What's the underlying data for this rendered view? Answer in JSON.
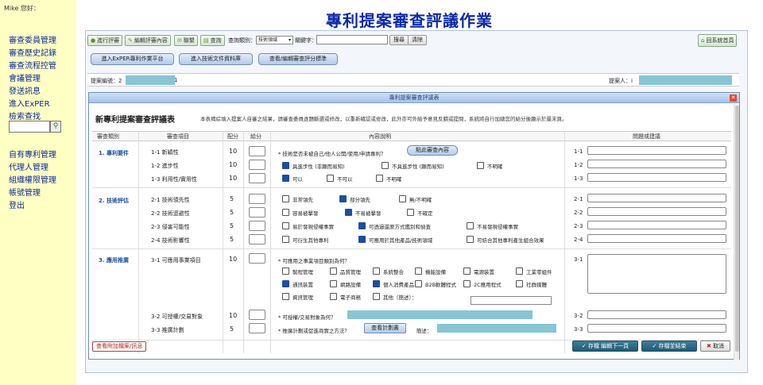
{
  "greeting": "Mike 您好：",
  "nav_top": [
    "審查委員管理",
    "審查歷史記錄",
    "審查流程控管",
    "會議管理",
    "發送訊息",
    "進入ExPER",
    "檢索查找"
  ],
  "nav_bottom": [
    "自有專利管理",
    "代理人管理",
    "組織權限管理",
    "帳號管理",
    "登出"
  ],
  "page_title": "專利提案審查評議作業",
  "toolbar": {
    "buttons": [
      "進行評審",
      "編輯評審內容",
      "聯繫",
      "查詢"
    ],
    "category_label": "查詢類別：",
    "category_value": "技術領域",
    "keyword_label": "關鍵字：",
    "search_label": "搜尋",
    "clear_label": "清除",
    "home_label": "回系統首頁"
  },
  "links": [
    "進入ExPER專利作業平台",
    "進入技術文件資料庫",
    "查看/編輯審查評分標準"
  ],
  "proposal": {
    "number_label": "提案編號：2",
    "number_tail": "1",
    "proposer_label": "提案人：i"
  },
  "dialog": {
    "title": "專利提案審查評議表",
    "form_title": "新專利提案審查評議表",
    "note": "本表揭綜填入提案人自審之結果，請審查委員逐題斷選或修改，以重新確認或修改，此外亦可外給予意見反饋或提問，系統將自行加總您的給分後顯示於最末頁。",
    "headers": [
      "審查類別",
      "審查項目",
      "配分",
      "給分",
      "內容說明",
      "問題或建議"
    ],
    "categories": [
      "1. 專利要件",
      "2. 技術評估",
      "3. 應用推廣"
    ],
    "items": [
      {
        "name": "1-1 新穎性",
        "weight": "10",
        "num": "1-1"
      },
      {
        "name": "1-2 進步性",
        "weight": "10",
        "num": "1-2"
      },
      {
        "name": "1-3 利用性/實用性",
        "weight": "10",
        "num": "1-3"
      },
      {
        "name": "2-1 技術領先性",
        "weight": "5",
        "num": "2-1"
      },
      {
        "name": "2-2 技術迴避性",
        "weight": "5",
        "num": "2-2"
      },
      {
        "name": "2-3 侵害可能性",
        "weight": "5",
        "num": "2-3"
      },
      {
        "name": "2-4 技術影響性",
        "weight": "5",
        "num": "2-4"
      },
      {
        "name": "3-1 可應用事業項目",
        "weight": "10",
        "num": "3-1"
      },
      {
        "name": "3-2 可授權/交易對象",
        "weight": "10",
        "num": "3-2"
      },
      {
        "name": "3-3 推廣計劃",
        "weight": "5",
        "num": "3-3"
      }
    ],
    "q11": "技術是否未被自己/他人公開/使用/申請專利？",
    "q11_btn": "點此審查內容",
    "q12_opts": [
      "具進步性 (非顯而易知)",
      "不具進步性 (顯而易知)",
      "不明確"
    ],
    "q13_opts": [
      "可以",
      "不可以",
      "不明確"
    ],
    "q21_opts": [
      "非常領先",
      "部分領先",
      "無/不明確"
    ],
    "q22_opts": [
      "容易被擊發",
      "不易被擊發",
      "不確定"
    ],
    "q23_opts": [
      "易於發現侵權事實",
      "可透過還原方式鑑別和偵查",
      "不易發現侵權事實"
    ],
    "q24_opts": [
      "可衍生其他專利",
      "可應用於其他產品/技術領域",
      "可結合其他專利產生組合效果"
    ],
    "q31": "可應用之事業項目類別為何？",
    "q31_opts": [
      "製程管理",
      "品質管理",
      "系統整合",
      "機能設備",
      "電源裝置",
      "工業零組件",
      "通訊裝置",
      "網路設備",
      "個人消費產品",
      "B2B軟體程式",
      "2C應用程式",
      "社群媒體",
      "資訊管理",
      "電子商務",
      "其他（簡述）："
    ],
    "q32": "可授權/交易對象為何？",
    "q33": "推廣計劃或促進商實之方法？",
    "q33_btn": "查看計劃書",
    "q33_brief": "簡述：",
    "attach_label": "查看附加檔案/訊息",
    "save_next": "存檔 編輯下一頁",
    "save_finish": "存檔並結束",
    "cancel": "取消",
    "checked": {
      "q12": 0,
      "q13": 0,
      "q21": 1,
      "q22": 1,
      "q23": 1,
      "q24": 1,
      "q31": [
        6,
        8
      ]
    }
  }
}
